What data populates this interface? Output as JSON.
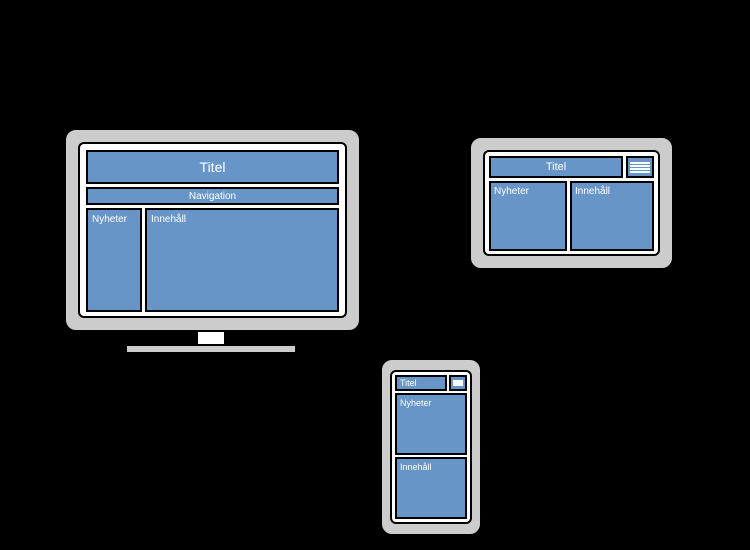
{
  "labels": {
    "title": "Titel",
    "navigation": "Navigation",
    "news": "Nyheter",
    "content": "Innehåll"
  }
}
